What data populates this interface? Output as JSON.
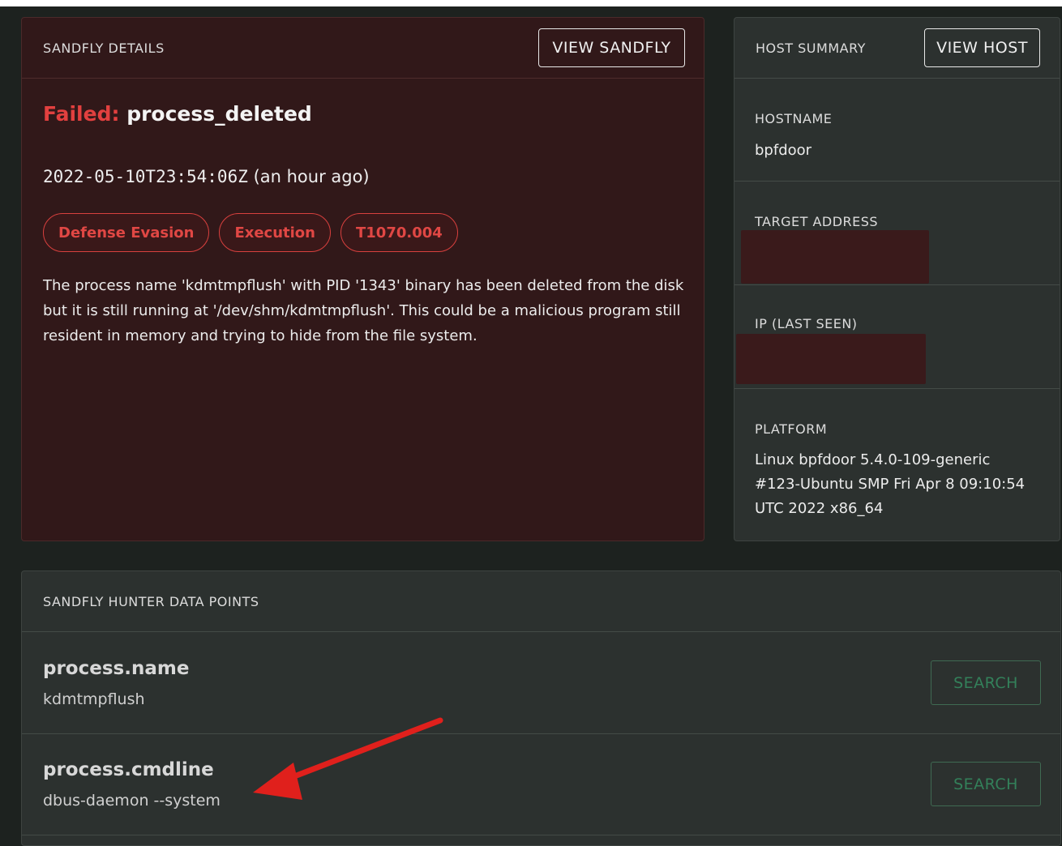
{
  "sandfly_details": {
    "header_title": "SANDFLY DETAILS",
    "view_button": "VIEW SANDFLY",
    "status_label": "Failed:",
    "sandfly_name": "process_deleted",
    "timestamp": "2022-05-10T23:54:06Z",
    "relative_time": "(an hour ago)",
    "tags": [
      "Defense Evasion",
      "Execution",
      "T1070.004"
    ],
    "description": "The process name 'kdmtmpflush' with PID '1343' binary has been deleted from the disk but it is still running at '/dev/shm/kdmtmpflush'. This could be a malicious program still resident in memory and trying to hide from the file system."
  },
  "host_summary": {
    "header_title": "HOST SUMMARY",
    "view_button": "VIEW HOST",
    "hostname_label": "HOSTNAME",
    "hostname": "bpfdoor",
    "target_address_label": "TARGET ADDRESS",
    "ip_label": "IP (LAST SEEN)",
    "platform_label": "PLATFORM",
    "platform": "Linux bpfdoor 5.4.0-109-generic #123-Ubuntu SMP Fri Apr 8 09:10:54 UTC 2022 x86_64"
  },
  "hunter_data_points": {
    "header_title": "SANDFLY HUNTER DATA POINTS",
    "rows": [
      {
        "key": "process.name",
        "value": "kdmtmpflush",
        "button": "SEARCH"
      },
      {
        "key": "process.cmdline",
        "value": "dbus-daemon --system",
        "button": "SEARCH"
      }
    ]
  },
  "colors": {
    "failed": "#e2403f",
    "tag_border": "#d8403e",
    "search_green": "#33805a",
    "annotation_arrow": "#e0201c"
  }
}
